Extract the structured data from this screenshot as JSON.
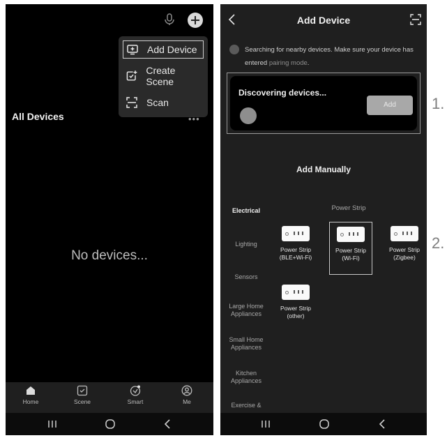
{
  "left_phone": {
    "menu": {
      "items": [
        {
          "label": "Add Device",
          "icon": "add-device-icon"
        },
        {
          "label": "Create Scene",
          "icon": "create-scene-icon"
        },
        {
          "label": "Scan",
          "icon": "scan-icon"
        }
      ]
    },
    "section_title": "All Devices",
    "more_icon": "more-dots-icon",
    "empty_text": "No devices...",
    "tabs": [
      {
        "label": "Home",
        "icon": "home-icon"
      },
      {
        "label": "Scene",
        "icon": "scene-icon"
      },
      {
        "label": "Smart",
        "icon": "smart-icon"
      },
      {
        "label": "Me",
        "icon": "me-icon"
      }
    ]
  },
  "right_phone": {
    "title": "Add Device",
    "search_text": "Searching for nearby devices. Make sure your device has entered",
    "search_link": "pairing mode",
    "search_end": ".",
    "discovering_title": "Discovering devices...",
    "add_button": "Add",
    "add_manually": "Add Manually",
    "categories": [
      "Electrical",
      "Lighting",
      "Sensors",
      "Large Home Appliances",
      "Small Home Appliances",
      "Kitchen Appliances",
      "Exercise &"
    ],
    "active_category": "Electrical",
    "group_title": "Power Strip",
    "devices": [
      {
        "name": "Power Strip (BLE+Wi-Fi)"
      },
      {
        "name": "Power Strip (Wi-Fi)"
      },
      {
        "name": "Power Strip (Zigbee)"
      },
      {
        "name": "Power Strip (other)"
      }
    ]
  },
  "annotations": [
    "1.",
    "2."
  ],
  "colors": {
    "dark_bg": "#000000",
    "panel_bg": "#1f1f1f",
    "menu_bg": "#2a2a2a",
    "button_disabled": "#a8a8a8"
  }
}
